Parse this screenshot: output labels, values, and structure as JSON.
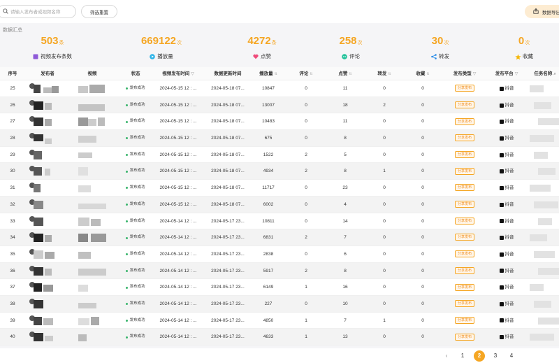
{
  "toolbar": {
    "search_placeholder": "请输入发布者或视频名称",
    "filter_reset_label": "筛选重置",
    "export_label": "数据导出"
  },
  "summary": {
    "title": "数据汇总",
    "stats": [
      {
        "value": "503",
        "unit": "条",
        "label": "视频发布条数",
        "icon": "video-icon",
        "color": "#8e5ad8"
      },
      {
        "value": "669122",
        "unit": "次",
        "label": "播放量",
        "icon": "play-icon",
        "color": "#2bb3e8"
      },
      {
        "value": "4272",
        "unit": "条",
        "label": "点赞",
        "icon": "heart-icon",
        "color": "#ef4a7a"
      },
      {
        "value": "258",
        "unit": "次",
        "label": "评论",
        "icon": "comment-icon",
        "color": "#23c29a"
      },
      {
        "value": "30",
        "unit": "次",
        "label": "转发",
        "icon": "share-icon",
        "color": "#2a8ce8"
      },
      {
        "value": "0",
        "unit": "次",
        "label": "收藏",
        "icon": "star-icon",
        "color": "#f5b70a"
      }
    ]
  },
  "table": {
    "columns": [
      "序号",
      "发布者",
      "视频",
      "状态",
      "视频发布时间",
      "数据更新时间",
      "播放量",
      "评论",
      "点赞",
      "转发",
      "收藏",
      "发布类型",
      "发布平台",
      "任务名称"
    ],
    "status_text": "发布成功",
    "type_text": "分享发布",
    "platform_text": "抖音",
    "rows": [
      {
        "id": "25",
        "pub": "2024-05-15 12 : ...",
        "upd": "2024-05-18 07...",
        "plays": "10847",
        "comments": "0",
        "likes": "11",
        "shares": "0",
        "favs": "0"
      },
      {
        "id": "26",
        "pub": "2024-05-15 12 : ...",
        "upd": "2024-05-18 07...",
        "plays": "13007",
        "comments": "0",
        "likes": "18",
        "shares": "2",
        "favs": "0"
      },
      {
        "id": "27",
        "pub": "2024-05-15 12 : ...",
        "upd": "2024-05-18 07...",
        "plays": "10483",
        "comments": "0",
        "likes": "11",
        "shares": "0",
        "favs": "0"
      },
      {
        "id": "28",
        "pub": "2024-05-15 12 : ...",
        "upd": "2024-05-18 07...",
        "plays": "675",
        "comments": "0",
        "likes": "8",
        "shares": "0",
        "favs": "0"
      },
      {
        "id": "29",
        "pub": "2024-05-15 12 : ...",
        "upd": "2024-05-18 07...",
        "plays": "1522",
        "comments": "2",
        "likes": "5",
        "shares": "0",
        "favs": "0"
      },
      {
        "id": "30",
        "pub": "2024-05-15 12 : ...",
        "upd": "2024-05-18 07...",
        "plays": "4934",
        "comments": "2",
        "likes": "8",
        "shares": "1",
        "favs": "0"
      },
      {
        "id": "31",
        "pub": "2024-05-15 12 : ...",
        "upd": "2024-05-18 07...",
        "plays": "11717",
        "comments": "0",
        "likes": "23",
        "shares": "0",
        "favs": "0"
      },
      {
        "id": "32",
        "pub": "2024-05-15 12 : ...",
        "upd": "2024-05-18 07...",
        "plays": "6002",
        "comments": "0",
        "likes": "4",
        "shares": "0",
        "favs": "0"
      },
      {
        "id": "33",
        "pub": "2024-05-14 12 : ...",
        "upd": "2024-05-17 23...",
        "plays": "10811",
        "comments": "0",
        "likes": "14",
        "shares": "0",
        "favs": "0"
      },
      {
        "id": "34",
        "pub": "2024-05-14 12 : ...",
        "upd": "2024-05-17 23...",
        "plays": "6831",
        "comments": "2",
        "likes": "7",
        "shares": "0",
        "favs": "0"
      },
      {
        "id": "35",
        "pub": "2024-05-14 12 : ...",
        "upd": "2024-05-17 23...",
        "plays": "2838",
        "comments": "0",
        "likes": "6",
        "shares": "0",
        "favs": "0"
      },
      {
        "id": "36",
        "pub": "2024-05-14 12 : ...",
        "upd": "2024-05-17 23...",
        "plays": "5917",
        "comments": "2",
        "likes": "8",
        "shares": "0",
        "favs": "0"
      },
      {
        "id": "37",
        "pub": "2024-05-14 12 : ...",
        "upd": "2024-05-17 23...",
        "plays": "6149",
        "comments": "1",
        "likes": "16",
        "shares": "0",
        "favs": "0"
      },
      {
        "id": "38",
        "pub": "2024-05-14 12 : ...",
        "upd": "2024-05-17 23...",
        "plays": "227",
        "comments": "0",
        "likes": "10",
        "shares": "0",
        "favs": "0"
      },
      {
        "id": "39",
        "pub": "2024-05-14 12 : ...",
        "upd": "2024-05-17 23...",
        "plays": "4850",
        "comments": "1",
        "likes": "7",
        "shares": "1",
        "favs": "0"
      },
      {
        "id": "40",
        "pub": "2024-05-14 12 : ...",
        "upd": "2024-05-17 23...",
        "plays": "4633",
        "comments": "1",
        "likes": "13",
        "shares": "0",
        "favs": "0"
      }
    ]
  },
  "pagination": {
    "prev": "‹",
    "pages": [
      "1",
      "2",
      "3",
      "4"
    ],
    "current": "2"
  }
}
